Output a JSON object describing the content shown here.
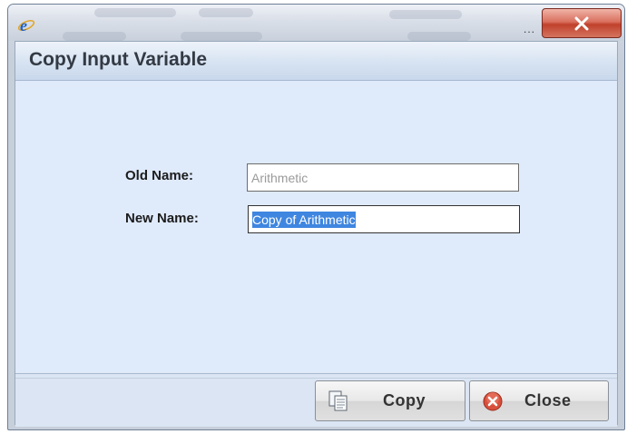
{
  "window": {
    "ellipsis": "...",
    "close_glyph": "X"
  },
  "dialog": {
    "title": "Copy Input Variable",
    "old_name": {
      "label": "Old Name:",
      "value": "Arithmetic"
    },
    "new_name": {
      "label": "New Name:",
      "value": "Copy of Arithmetic"
    }
  },
  "buttons": {
    "copy_label": "Copy",
    "close_label": "Close"
  },
  "icons": {
    "browser": "ie-logo-icon",
    "copy": "copy-documents-icon",
    "close": "red-circle-x-icon"
  },
  "colors": {
    "panel_background": "#dfeafb",
    "selection": "#3f86e0",
    "window_close": "#c0412c"
  }
}
